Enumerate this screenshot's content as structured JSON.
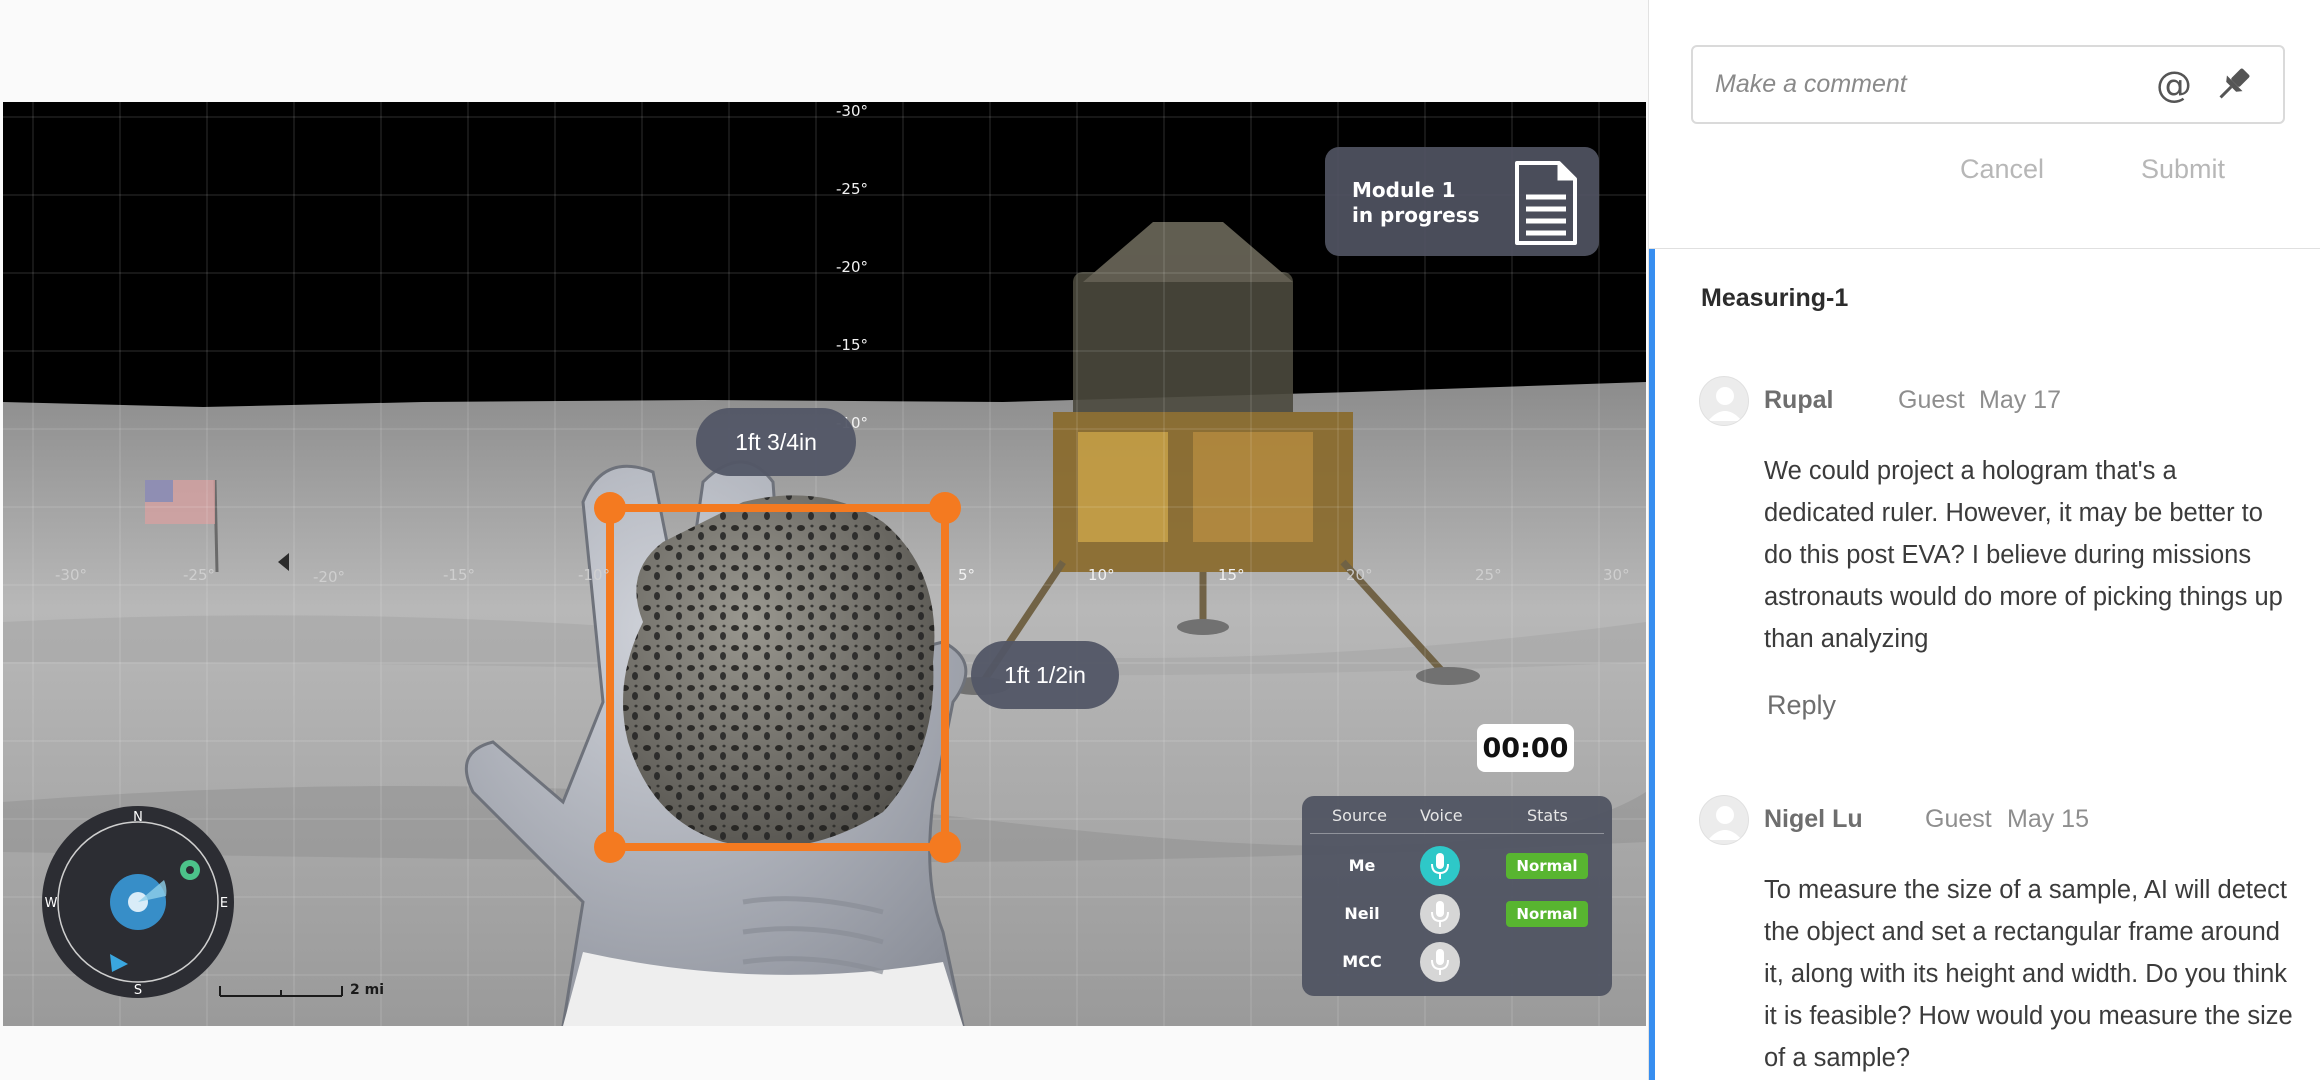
{
  "scene": {
    "vertical_ticks": [
      "-30°",
      "-25°",
      "-20°",
      "-15°",
      "-10°"
    ],
    "horizontal_ticks": [
      "-30°",
      "-25°",
      "-20°",
      "-15°",
      "-10°",
      "5°",
      "10°",
      "15°",
      "20°",
      "25°",
      "30°"
    ],
    "module_card": {
      "line1": "Module 1",
      "line2": "in progress",
      "icon": "document-icon"
    },
    "measurements": {
      "height": "1ft 3/4in",
      "width": "1ft 1/2in"
    },
    "timer": "00:00",
    "comm_panel": {
      "headers": {
        "source": "Source",
        "voice": "Voice",
        "stats": "Stats"
      },
      "rows": [
        {
          "source": "Me",
          "voice_active": true,
          "stats": "Normal"
        },
        {
          "source": "Neil",
          "voice_active": false,
          "stats": "Normal"
        },
        {
          "source": "MCC",
          "voice_active": false,
          "stats": ""
        }
      ]
    },
    "compass": {
      "north": "N",
      "south": "S",
      "east": "E",
      "west": "W"
    },
    "scale": "2 mi",
    "colors": {
      "frame": "#f47a20",
      "active_mic": "#2ec8c8",
      "normal_badge": "#58b530"
    }
  },
  "panel": {
    "comment_placeholder": "Make a comment",
    "mention_icon": "@",
    "cancel_label": "Cancel",
    "submit_label": "Submit",
    "thread_title": "Measuring-1",
    "accent_color": "#378ef0",
    "comments": [
      {
        "author": "Rupal",
        "role": "Guest",
        "date": "May 17",
        "body": "We could project a hologram that's a dedicated ruler. However, it may be better to do this post EVA? I believe during missions astronauts would do more of picking things up than analyzing",
        "reply_label": "Reply"
      },
      {
        "author": "Nigel Lu",
        "role": "Guest",
        "date": "May 15",
        "body": "To measure the size of a sample, AI will detect the object and set a rectangular frame around it, along with its height and width.  Do you think it is feasible? How would you measure the size of a sample?"
      }
    ]
  }
}
